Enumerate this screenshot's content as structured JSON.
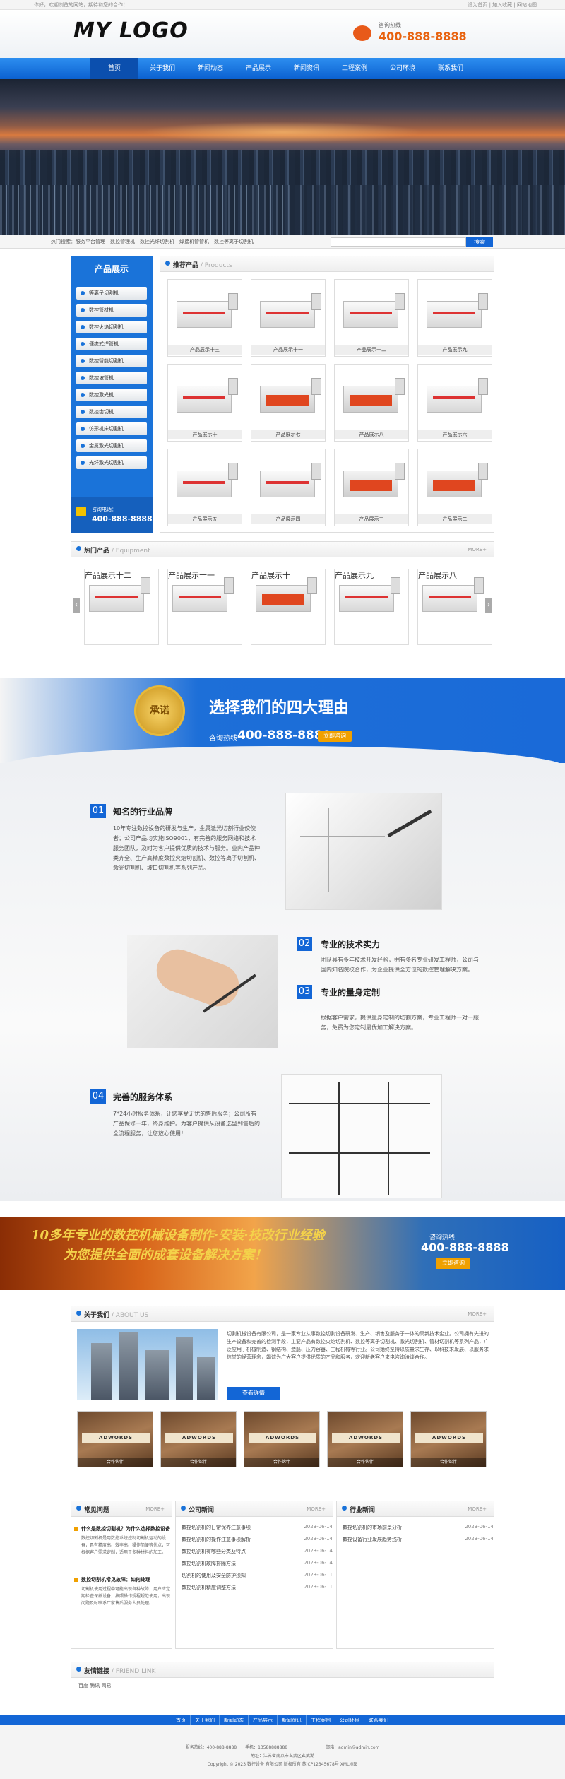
{
  "topbar": {
    "left": "你好，欢迎浏览的网站，期待和您的合作！",
    "right": "设为首页 | 加入收藏 | 网站地图"
  },
  "header": {
    "logo": "MY LOGO",
    "hotline_label": "咨询热线",
    "hotline_number": "400-888-8888"
  },
  "nav": {
    "items": [
      "首页",
      "关于我们",
      "新闻动态",
      "产品展示",
      "新闻资讯",
      "工程案例",
      "公司环境",
      "联系我们"
    ],
    "active": 0
  },
  "search": {
    "hot_label": "热门搜索：服务平台管理　数控管理机　数控光纤切割机　焊接机管管机　数控等离子切割机",
    "button": "搜索"
  },
  "sidebar": {
    "title": "产品展示",
    "items": [
      "等离子切割机",
      "数控管材机",
      "数控火焰切割机",
      "便携式焊管机",
      "数控智能切割机",
      "数控坡管机",
      "数控激光机",
      "数控齿切机",
      "仿形机床切割机",
      "金属激光切割机",
      "光纤激光切割机"
    ],
    "hotline_label": "咨询电话：",
    "hotline_number": "400-888-8888"
  },
  "recommended": {
    "title": "推荐产品",
    "title_en": "Products",
    "cards": [
      "产品展示十三",
      "产品展示十一",
      "产品展示十二",
      "产品展示九",
      "产品展示十",
      "产品展示七",
      "产品展示八",
      "产品展示六",
      "产品展示五",
      "产品展示四",
      "产品展示三",
      "产品展示二"
    ]
  },
  "hot": {
    "title": "热门产品",
    "title_en": "Equipment",
    "more": "MORE+",
    "cards": [
      "产品展示十二",
      "产品展示十一",
      "产品展示十",
      "产品展示九",
      "产品展示八"
    ]
  },
  "reasons": {
    "medal": "承诺",
    "title": "选择我们的四大理由",
    "hotline_label": "咨询热线：",
    "hotline_number": "400-888-8888",
    "button": "立即咨询"
  },
  "why": [
    {
      "num": "01",
      "title": "知名的行业品牌",
      "desc": "10年专注数控设备的研发与生产，金属激光切割行业佼佼者；公司产品均实施ISO9001，有完善的服务网络和技术服务团队，及时为客户提供优质的技术与服务。业内产品种类齐全、生产高精度数控火焰切割机、数控等离子切割机、激光切割机、坡口切割机等系列产品。"
    },
    {
      "num": "02",
      "title": "专业的技术实力",
      "desc": "团队具有多年技术开发经验，拥有多名专业研发工程师，公司与国内知名院校合作，为企业提供全方位的数控管理解决方案。"
    },
    {
      "num": "03",
      "title": "专业的量身定制",
      "desc": "根据客户需求，提供量身定制的切割方案，专业工程师一对一服务，免费为您定制最优加工解决方案。"
    },
    {
      "num": "04",
      "title": "完善的服务体系",
      "desc": "7*24小时服务体系，让您享受无忧的售后服务；公司所有产品保修一年，终身维护。为客户提供从设备选型到售后的全流程服务，让您放心使用！"
    }
  ],
  "promo": {
    "line1": "10多年专业的数控机械设备制作·安装·技改行业经验",
    "line2": "为您提供全面的成套设备解决方案！",
    "call_label": "咨询热线",
    "call_number": "400-888-8888",
    "button": "立即咨询"
  },
  "about": {
    "title": "关于我们",
    "title_en": "ABOUT US",
    "more": "MORE+",
    "text": "切割机械设备有限公司，是一家专业从事数控切割设备研发、生产、销售及服务于一体的高新技术企业。公司拥有先进的生产设备和完善的检测手段，主要产品有数控火焰切割机、数控等离子切割机、激光切割机、管材切割机等系列产品，广泛应用于机械制造、钢结构、造船、压力容器、工程机械等行业。公司始终坚持以质量求生存、以科技求发展、以服务求信誉的经营理念，竭诚为广大客户提供优质的产品和服务，欢迎新老客户来电咨询洽谈合作。",
    "button": "查看详情",
    "gallery": [
      {
        "word": "ADWORDS",
        "cap": "合作伙伴"
      },
      {
        "word": "ADWORDS",
        "cap": "合作伙伴"
      },
      {
        "word": "ADWORDS",
        "cap": "合作伙伴"
      },
      {
        "word": "ADWORDS",
        "cap": "合作伙伴"
      },
      {
        "word": "ADWORDS",
        "cap": "合作伙伴"
      }
    ]
  },
  "faq": {
    "title": "常见问题",
    "more": "MORE+",
    "items": [
      {
        "q": "什么是数控切割机？为什么选择数控设备",
        "a": "数控切割机是用数控系统控制切割机运动的设备，具有精度高、效率高、操作简便等优点，可根据客户需求定制，适用于多种材料的加工。"
      },
      {
        "q": "数控切割机常见故障：如何处理",
        "a": "切割机使用过程中可能出现各种故障，用户应定期检查保养设备，按照操作规程规范使用，出现问题及时联系厂家售后服务人员处理。"
      }
    ]
  },
  "company_news": {
    "title": "公司新闻",
    "more": "MORE+",
    "items": [
      {
        "t": "数控切割机的日常保养注意事项",
        "d": "2023-06-14"
      },
      {
        "t": "数控切割机的操作注意事项解析",
        "d": "2023-06-14"
      },
      {
        "t": "数控切割机有哪些分类及特点",
        "d": "2023-06-14"
      },
      {
        "t": "数控切割机故障排除方法",
        "d": "2023-06-14"
      },
      {
        "t": "切割机的使用及安全防护须知",
        "d": "2023-06-11"
      },
      {
        "t": "数控切割机精度调整方法",
        "d": "2023-06-11"
      }
    ]
  },
  "industry_news": {
    "title": "行业新闻",
    "more": "MORE+",
    "items": [
      {
        "t": "数控切割机的市场前景分析",
        "d": "2023-06-14"
      },
      {
        "t": "数控设备行业发展趋势浅析",
        "d": "2023-06-14"
      }
    ]
  },
  "links": {
    "title": "友情链接",
    "title_en": "FRIEND LINK",
    "items": "百度 腾讯 网易"
  },
  "footer": {
    "nav": [
      "首页",
      "关于我们",
      "新闻动态",
      "产品展示",
      "新闻资讯",
      "工程案例",
      "公司环境",
      "联系我们"
    ],
    "line1": "服务热线：400-888-8888　　手机：13588888888　　　　　　　　　邮箱：admin@admin.com",
    "line2": "地址：江苏省南京市玄武区玄武湖",
    "line3": "Copyright © 2023 数控设备 有限公司 版权所有 苏ICP12345678号 XML地图"
  }
}
